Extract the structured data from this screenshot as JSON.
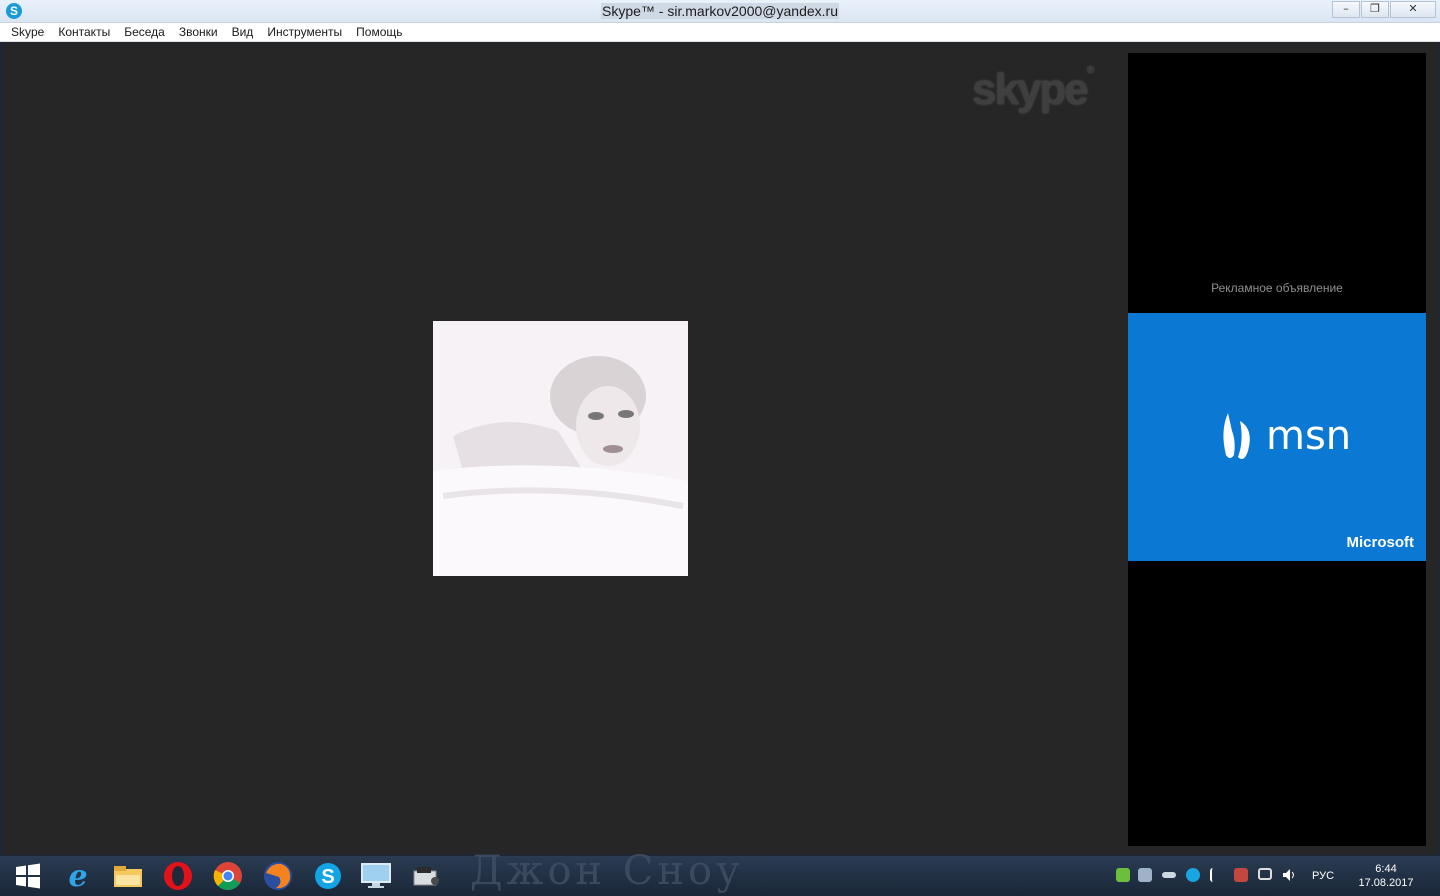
{
  "window": {
    "title": "Skype™ - sir.markov2000@yandex.ru",
    "app_icon_letter": "S",
    "controls": {
      "minimize": "–",
      "maximize": "❐",
      "close": "✕"
    }
  },
  "menu": [
    "Skype",
    "Контакты",
    "Беседа",
    "Звонки",
    "Вид",
    "Инструменты",
    "Помощь"
  ],
  "call": {
    "watermark_logo": "skype",
    "watermark_tm": "®"
  },
  "ad": {
    "caption": "Рекламное объявление",
    "brand": "msn",
    "company": "Microsoft",
    "banner_color": "#0b78d4"
  },
  "taskbar": {
    "wallpaper_text": "Джон Сноу",
    "pinned": [
      "windows-start-icon",
      "internet-explorer-icon",
      "file-explorer-icon",
      "opera-icon",
      "chrome-icon",
      "firefox-icon",
      "skype-icon",
      "remote-desktop-icon",
      "media-icon"
    ],
    "language": "РУС",
    "time": "6:44",
    "date": "17.08.2017"
  },
  "colors": {
    "call_background": "#262626",
    "accent_skype": "#1a9ad9"
  }
}
